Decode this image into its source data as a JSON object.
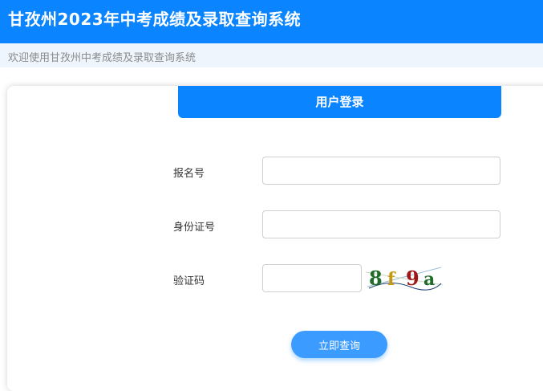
{
  "header": {
    "title": "甘孜州2023年中考成绩及录取查询系统"
  },
  "subbar": {
    "welcome": "欢迎使用甘孜州中考成绩及录取查询系统"
  },
  "login": {
    "tab_label": "用户登录",
    "fields": [
      {
        "label": "报名号",
        "value": "",
        "placeholder": ""
      },
      {
        "label": "身份证号",
        "value": "",
        "placeholder": ""
      },
      {
        "label": "验证码",
        "value": "",
        "placeholder": ""
      }
    ],
    "captcha_text": "8f9a",
    "submit_label": "立即查询"
  },
  "colors": {
    "primary": "#0a84ff",
    "button": "#3b9bff",
    "subbar_bg": "#eef5fd"
  }
}
